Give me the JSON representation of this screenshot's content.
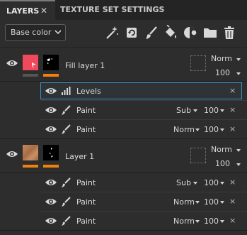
{
  "tabs": {
    "layers": "LAYERS",
    "close": "✕",
    "texture_set_settings": "TEXTURE SET SETTINGS"
  },
  "toolbar": {
    "channel": "Base color",
    "icons": [
      "magic-wand-icon",
      "rotate-fill-icon",
      "brush-icon",
      "bucket-fill-icon",
      "mask-icon",
      "folder-icon",
      "trash-icon"
    ]
  },
  "layers": [
    {
      "name": "Fill layer 1",
      "blend": "Norm",
      "opacity": "100",
      "thumb_color": "#f0495c",
      "effects": [
        {
          "name": "Levels",
          "icon": "levels-icon",
          "close": "×",
          "selected": true
        },
        {
          "name": "Paint",
          "icon": "brush-icon",
          "blend": "Sub",
          "opacity": "100",
          "close": "×"
        },
        {
          "name": "Paint",
          "icon": "brush-icon",
          "blend": "Norm",
          "opacity": "100",
          "close": "×"
        }
      ]
    },
    {
      "name": "Layer 1",
      "blend": "Norm",
      "opacity": "100",
      "thumb_color": "#b57a52",
      "effects": [
        {
          "name": "Paint",
          "icon": "brush-icon",
          "blend": "Sub",
          "opacity": "100",
          "close": "×"
        },
        {
          "name": "Paint",
          "icon": "brush-icon",
          "blend": "Norm",
          "opacity": "100",
          "close": "×"
        },
        {
          "name": "Paint",
          "icon": "brush-icon",
          "blend": "Norm",
          "opacity": "100",
          "close": "×"
        }
      ]
    }
  ],
  "colors": {
    "accent_orange": "#f2800f",
    "selection_blue": "#3c8fc7"
  }
}
